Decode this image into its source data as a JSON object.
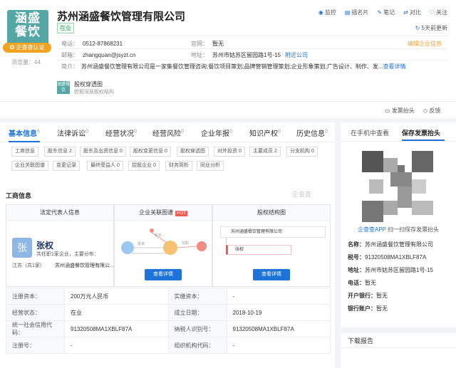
{
  "header": {
    "logo_text": "涵盛餐饮",
    "logo_line1": "涵盛",
    "logo_line2": "餐饮",
    "logo_badge": "企查查认证",
    "views": "浏览量：44",
    "company_name": "苏州涵盛餐饮管理有限公司",
    "status": "在业",
    "actions": [
      "监控",
      "插名片",
      "笔记",
      "对比",
      "关注"
    ],
    "action_icons": [
      "eye-icon",
      "card-icon",
      "note-icon",
      "compare-icon",
      "heart-icon"
    ],
    "updated": "5天前更新",
    "phone_label": "电话：",
    "phone": "0512-87868231",
    "website_label": "官网：",
    "website": "暂无",
    "edit_link": "编辑企业信息",
    "email_label": "邮箱：",
    "email": "zhangquan@jsyzt.cn",
    "address_label": "地址：",
    "address": "苏州市姑苏区留园路1号-15",
    "nearby": "附近公司",
    "intro_label": "简介：",
    "intro": "苏州涵盛餐饮管理有限公司是一家集餐饮管理咨询;餐饮项目策划;品牌营销管理策划;企业形象策划;广告设计、制作、发...",
    "intro_more": "查看详情",
    "equity_icon_text": "涵盛餐饮",
    "equity_title": "股权穿透图",
    "equity_sub": "挖掘深层股权结构"
  },
  "bar": {
    "report": "发票抬头",
    "feedback": "反馈"
  },
  "tabs": [
    {
      "label": "基本信息",
      "count": "6"
    },
    {
      "label": "法律诉讼",
      "count": "0"
    },
    {
      "label": "经营状况",
      "count": "0"
    },
    {
      "label": "经营风险",
      "count": "0"
    },
    {
      "label": "企业年报",
      "count": "0"
    },
    {
      "label": "知识产权",
      "count": "0"
    },
    {
      "label": "历史信息",
      "count": "0"
    }
  ],
  "chips_row1": [
    "工商信息",
    "股东信息 2",
    "股东及出资信息 0",
    "股权变更信息 0",
    "股权穿透图",
    "对外投资 0",
    "主要成员 2",
    "分支机构 0"
  ],
  "chips_row2": [
    "企业关联图谱",
    "变更记录",
    "最终受益人 0",
    "控股企业 0",
    "财务简析",
    "同业分析"
  ],
  "section_title": "工商信息",
  "watermark": "企查查",
  "panels": {
    "legal_title": "法定代表人信息",
    "graph_title": "企业关联图谱",
    "hot": "HOT",
    "structure_title": "股权结构图",
    "avatar": "张",
    "legal_name": "张权",
    "legal_desc": "共任职1家企业，主要分布：",
    "legal_region": "江苏（共1家）",
    "legal_company": "苏州涵盛餐饮管理有限公...",
    "graph_nodes": [
      "投资",
      "股东",
      "任职"
    ],
    "structure_company": "苏州涵盛餐饮管理有限公司",
    "structure_holder": "张权",
    "view": "查看详情"
  },
  "info_table": [
    [
      "注册资本：",
      "200万元人民币",
      "实缴资本：",
      "-"
    ],
    [
      "经营状态：",
      "在业",
      "成立日期：",
      "2018-10-19"
    ],
    [
      "统一社会信用代码：",
      "91320508MA1XBLF87A",
      "纳税人识别号：",
      "91320508MA1XBLF87A"
    ],
    [
      "注册号：",
      "-",
      "组织机构代码：",
      "-"
    ]
  ],
  "side": {
    "tab1": "在手机中查看",
    "tab2": "保存发票抬头",
    "app_link": "企查查APP",
    "app_text": "扫一扫保存发票抬头",
    "name_label": "名称：",
    "name": "苏州涵盛餐饮管理有限公司",
    "tax_label": "税号：",
    "tax": "91320508MA1XBLF87A",
    "addr_label": "地址：",
    "addr": "苏州市姑苏区留园路1号-15",
    "phone_label": "电话：",
    "phone": "暂无",
    "bank_label": "开户银行：",
    "bank": "暂无",
    "account_label": "银行账户：",
    "account": "暂无",
    "download": "下载报告"
  }
}
